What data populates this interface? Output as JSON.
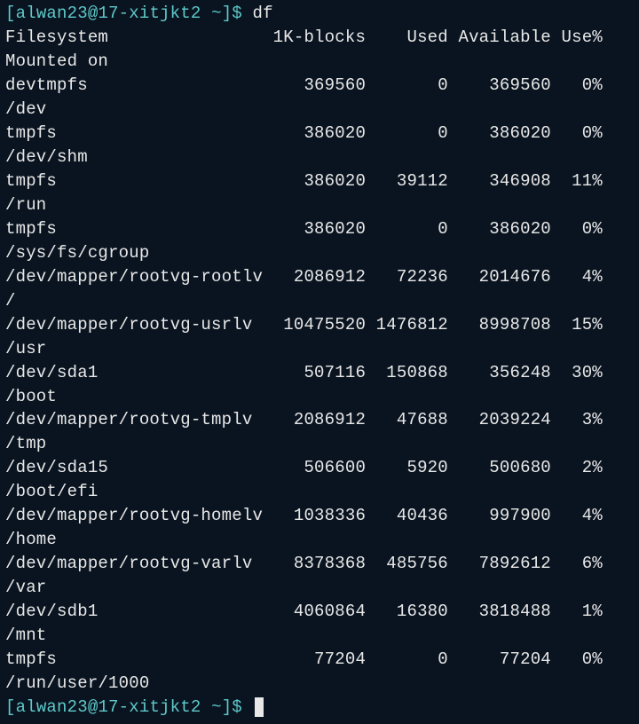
{
  "prompt": {
    "user": "alwan23",
    "host": "17-xitjkt2",
    "path": "~",
    "symbol": "$",
    "command": "df"
  },
  "headers": {
    "filesystem": "Filesystem",
    "blocks": "1K-blocks",
    "used": "Used",
    "available": "Available",
    "usepct": "Use%",
    "mounted": "Mounted on"
  },
  "rows": [
    {
      "fs": "devtmpfs",
      "blocks": "369560",
      "used": "0",
      "avail": "369560",
      "use": "0%",
      "mount": "/dev"
    },
    {
      "fs": "tmpfs",
      "blocks": "386020",
      "used": "0",
      "avail": "386020",
      "use": "0%",
      "mount": "/dev/shm"
    },
    {
      "fs": "tmpfs",
      "blocks": "386020",
      "used": "39112",
      "avail": "346908",
      "use": "11%",
      "mount": "/run"
    },
    {
      "fs": "tmpfs",
      "blocks": "386020",
      "used": "0",
      "avail": "386020",
      "use": "0%",
      "mount": "/sys/fs/cgroup"
    },
    {
      "fs": "/dev/mapper/rootvg-rootlv",
      "blocks": "2086912",
      "used": "72236",
      "avail": "2014676",
      "use": "4%",
      "mount": "/"
    },
    {
      "fs": "/dev/mapper/rootvg-usrlv",
      "blocks": "10475520",
      "used": "1476812",
      "avail": "8998708",
      "use": "15%",
      "mount": "/usr"
    },
    {
      "fs": "/dev/sda1",
      "blocks": "507116",
      "used": "150868",
      "avail": "356248",
      "use": "30%",
      "mount": "/boot"
    },
    {
      "fs": "/dev/mapper/rootvg-tmplv",
      "blocks": "2086912",
      "used": "47688",
      "avail": "2039224",
      "use": "3%",
      "mount": "/tmp"
    },
    {
      "fs": "/dev/sda15",
      "blocks": "506600",
      "used": "5920",
      "avail": "500680",
      "use": "2%",
      "mount": "/boot/efi"
    },
    {
      "fs": "/dev/mapper/rootvg-homelv",
      "blocks": "1038336",
      "used": "40436",
      "avail": "997900",
      "use": "4%",
      "mount": "/home"
    },
    {
      "fs": "/dev/mapper/rootvg-varlv",
      "blocks": "8378368",
      "used": "485756",
      "avail": "7892612",
      "use": "6%",
      "mount": "/var"
    },
    {
      "fs": "/dev/sdb1",
      "blocks": "4060864",
      "used": "16380",
      "avail": "3818488",
      "use": "1%",
      "mount": "/mnt"
    },
    {
      "fs": "tmpfs",
      "blocks": "77204",
      "used": "0",
      "avail": "77204",
      "use": "0%",
      "mount": "/run/user/1000"
    }
  ]
}
